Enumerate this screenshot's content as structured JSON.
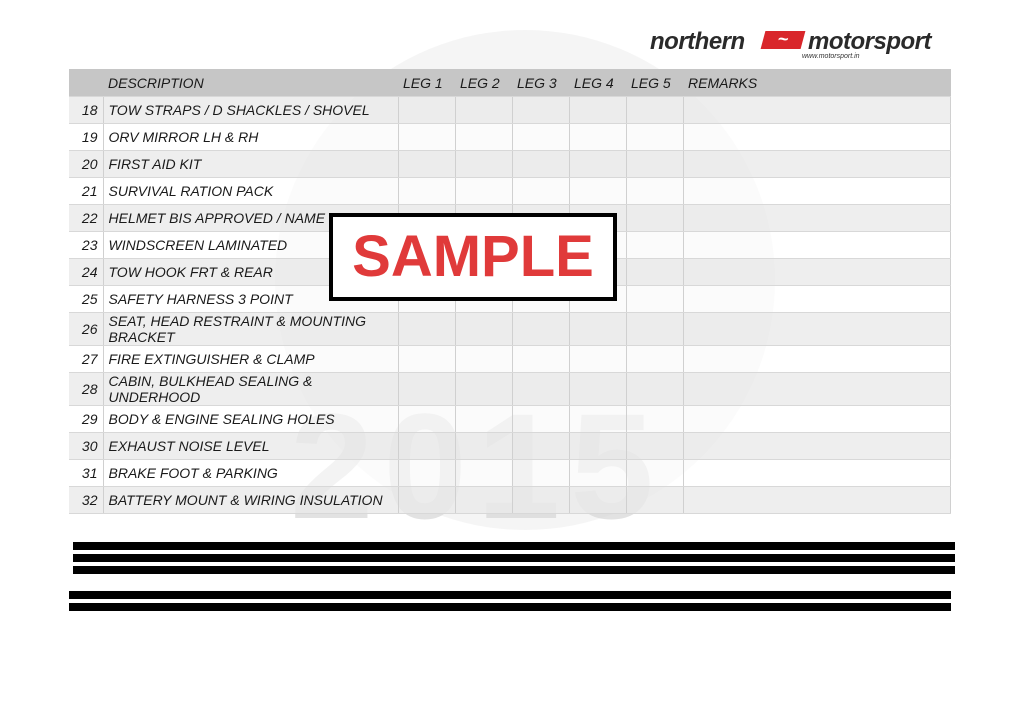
{
  "logo": {
    "left": "northern",
    "right": "motorsport",
    "url": "www.motorsport.in",
    "brand_color": "#d9262b"
  },
  "watermark": "2015",
  "stamp": "SAMPLE",
  "table": {
    "headers": [
      "",
      "DESCRIPTION",
      "LEG 1",
      "LEG 2",
      "LEG 3",
      "LEG 4",
      "LEG 5",
      "REMARKS"
    ],
    "rows": [
      {
        "n": "18",
        "d": "TOW STRAPS / D SHACKLES / SHOVEL"
      },
      {
        "n": "19",
        "d": "ORV MIRROR LH & RH"
      },
      {
        "n": "20",
        "d": "FIRST AID KIT"
      },
      {
        "n": "21",
        "d": "SURVIVAL RATION PACK"
      },
      {
        "n": "22",
        "d": "HELMET BIS APPROVED / NAME ID"
      },
      {
        "n": "23",
        "d": "WINDSCREEN LAMINATED"
      },
      {
        "n": "24",
        "d": "TOW HOOK FRT & REAR"
      },
      {
        "n": "25",
        "d": "SAFETY HARNESS 3 POINT"
      },
      {
        "n": "26",
        "d": "SEAT, HEAD RESTRAINT & MOUNTING BRACKET"
      },
      {
        "n": "27",
        "d": "FIRE EXTINGUISHER & CLAMP"
      },
      {
        "n": "28",
        "d": "CABIN, BULKHEAD SEALING & UNDERHOOD"
      },
      {
        "n": "29",
        "d": "BODY & ENGINE SEALING HOLES"
      },
      {
        "n": "30",
        "d": "EXHAUST NOISE LEVEL"
      },
      {
        "n": "31",
        "d": "BRAKE FOOT & PARKING"
      },
      {
        "n": "32",
        "d": "BATTERY MOUNT & WIRING INSULATION"
      }
    ]
  }
}
